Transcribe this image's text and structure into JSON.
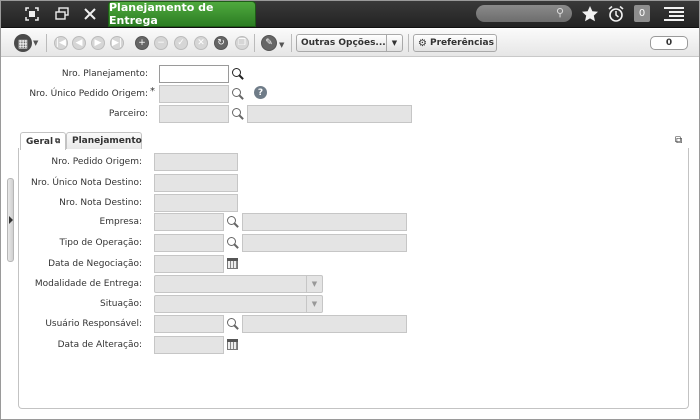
{
  "window": {
    "title": "Planejamento de Entrega",
    "notification_count": "0",
    "icons": [
      "fullscreen-icon",
      "restore-icon",
      "close-icon",
      "search-icon",
      "star-icon",
      "alarm-icon",
      "menu-icon"
    ]
  },
  "toolbar": {
    "more_options_label": "Outras Opções...",
    "preferences_label": "Preferências",
    "record_counter": "0",
    "icons": [
      "grid-menu-icon",
      "first-record-icon",
      "previous-record-icon",
      "next-record-icon",
      "last-record-icon",
      "add-icon",
      "remove-icon",
      "confirm-icon",
      "cancel-icon",
      "refresh-icon",
      "copy-icon",
      "wrench-icon",
      "gear-icon"
    ]
  },
  "header_form": {
    "nro_planejamento": {
      "label": "Nro. Planejamento:",
      "value": ""
    },
    "nro_unico_pedido_origem": {
      "label": "Nro. Único Pedido Origem:",
      "required_mark": "*",
      "value": ""
    },
    "parceiro": {
      "label": "Parceiro:",
      "code": "",
      "name": ""
    }
  },
  "tabs": [
    {
      "label": "Geral",
      "active": true
    },
    {
      "label": "Planejamento",
      "active": false
    }
  ],
  "geral": {
    "nro_pedido_origem": {
      "label": "Nro. Pedido Origem:",
      "value": ""
    },
    "nro_unico_nota_destino": {
      "label": "Nro. Único Nota Destino:",
      "value": ""
    },
    "nro_nota_destino": {
      "label": "Nro. Nota Destino:",
      "value": ""
    },
    "empresa": {
      "label": "Empresa:",
      "code": "",
      "name": ""
    },
    "tipo_operacao": {
      "label": "Tipo de Operação:",
      "code": "",
      "name": ""
    },
    "data_negociacao": {
      "label": "Data de Negociação:",
      "value": ""
    },
    "modalidade_entrega": {
      "label": "Modalidade de Entrega:",
      "value": ""
    },
    "situacao": {
      "label": "Situação:",
      "value": ""
    },
    "usuario_responsavel": {
      "label": "Usuário Responsável:",
      "code": "",
      "name": ""
    },
    "data_alteracao": {
      "label": "Data de Alteração:",
      "value": ""
    }
  }
}
